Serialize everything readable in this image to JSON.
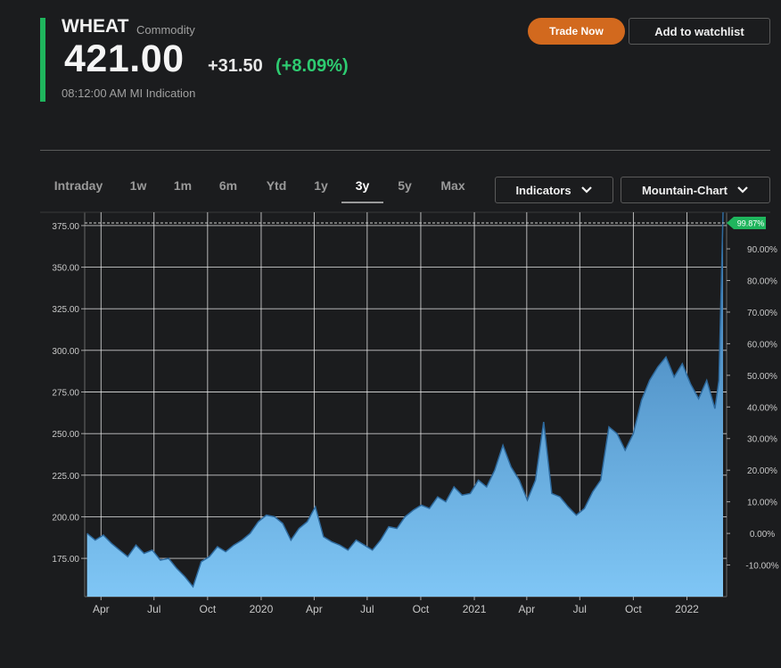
{
  "header": {
    "symbol": "WHEAT",
    "asset_type": "Commodity",
    "price": "421.00",
    "change_abs": "+31.50",
    "change_pct": "(+8.09%)",
    "timestamp": "08:12:00 AM  MI Indication",
    "trade_label": "Trade Now",
    "watchlist_label": "Add to watchlist"
  },
  "tabs": [
    {
      "label": "Intraday"
    },
    {
      "label": "1w"
    },
    {
      "label": "1m"
    },
    {
      "label": "6m"
    },
    {
      "label": "Ytd"
    },
    {
      "label": "1y"
    },
    {
      "label": "3y",
      "active": true
    },
    {
      "label": "5y"
    },
    {
      "label": "Max"
    }
  ],
  "dropdowns": {
    "indicators": "Indicators",
    "chart_type": "Mountain-Chart"
  },
  "colors": {
    "accent": "#1fb55d",
    "up": "#2ecc71",
    "trade": "#d2691e",
    "area_top": "#3a78b0",
    "area_bottom": "#7fc6f5"
  },
  "chart_data": {
    "type": "area",
    "xlim": [
      "2019-03",
      "2022-03"
    ],
    "ylim": [
      152,
      383
    ],
    "y_ticks": [
      175,
      200,
      225,
      250,
      275,
      300,
      325,
      350,
      375
    ],
    "y_tick_labels": [
      "175.00",
      "200.00",
      "225.00",
      "250.00",
      "275.00",
      "300.00",
      "325.00",
      "350.00",
      "375.00"
    ],
    "y2_ticks": [
      -10,
      0,
      10,
      20,
      30,
      40,
      50,
      60,
      70,
      80,
      90
    ],
    "y2_tick_labels": [
      "-10.00%",
      "0.00%",
      "10.00%",
      "20.00%",
      "30.00%",
      "40.00%",
      "50.00%",
      "60.00%",
      "70.00%",
      "80.00%",
      "90.00%"
    ],
    "x_ticks": [
      "2019-04",
      "2019-07",
      "2019-10",
      "2020-01",
      "2020-04",
      "2020-07",
      "2020-10",
      "2021-01",
      "2021-04",
      "2021-07",
      "2021-10",
      "2022-01"
    ],
    "x_tick_labels": [
      "Apr",
      "Jul",
      "Oct",
      "2020",
      "Apr",
      "Jul",
      "Oct",
      "2021",
      "Apr",
      "Jul",
      "Oct",
      "2022"
    ],
    "last_change_label": "99.87%",
    "grid": true,
    "x": [
      "2019-03-08",
      "2019-03-22",
      "2019-04-05",
      "2019-04-19",
      "2019-05-03",
      "2019-05-17",
      "2019-05-31",
      "2019-06-14",
      "2019-06-28",
      "2019-07-12",
      "2019-07-26",
      "2019-08-09",
      "2019-08-23",
      "2019-09-06",
      "2019-09-20",
      "2019-10-04",
      "2019-10-18",
      "2019-11-01",
      "2019-11-15",
      "2019-11-29",
      "2019-12-13",
      "2019-12-27",
      "2020-01-10",
      "2020-01-24",
      "2020-02-07",
      "2020-02-21",
      "2020-03-06",
      "2020-03-20",
      "2020-04-03",
      "2020-04-17",
      "2020-05-01",
      "2020-05-15",
      "2020-05-29",
      "2020-06-12",
      "2020-06-26",
      "2020-07-10",
      "2020-07-24",
      "2020-08-07",
      "2020-08-21",
      "2020-09-04",
      "2020-09-18",
      "2020-10-02",
      "2020-10-16",
      "2020-10-30",
      "2020-11-13",
      "2020-11-27",
      "2020-12-11",
      "2020-12-25",
      "2021-01-08",
      "2021-01-22",
      "2021-02-05",
      "2021-02-19",
      "2021-03-05",
      "2021-03-19",
      "2021-04-02",
      "2021-04-16",
      "2021-04-30",
      "2021-05-14",
      "2021-05-28",
      "2021-06-11",
      "2021-06-25",
      "2021-07-09",
      "2021-07-23",
      "2021-08-06",
      "2021-08-20",
      "2021-09-03",
      "2021-09-17",
      "2021-10-01",
      "2021-10-15",
      "2021-10-29",
      "2021-11-12",
      "2021-11-26",
      "2021-12-10",
      "2021-12-24",
      "2022-01-07",
      "2022-01-21",
      "2022-02-04",
      "2022-02-18",
      "2022-02-25",
      "2022-03-04"
    ],
    "values": [
      190,
      186,
      189,
      184,
      180,
      176,
      183,
      178,
      180,
      174,
      175,
      169,
      164,
      158,
      173,
      176,
      182,
      179,
      183,
      186,
      190,
      197,
      201,
      200,
      196,
      186,
      193,
      197,
      206,
      188,
      185,
      183,
      180,
      186,
      183,
      180,
      186,
      194,
      193,
      200,
      204,
      207,
      205,
      212,
      209,
      218,
      213,
      214,
      222,
      218,
      228,
      243,
      230,
      222,
      210,
      222,
      257,
      214,
      212,
      206,
      201,
      205,
      215,
      222,
      254,
      250,
      240,
      250,
      270,
      282,
      290,
      296,
      284,
      292,
      280,
      271,
      282,
      265,
      282,
      383
    ]
  }
}
